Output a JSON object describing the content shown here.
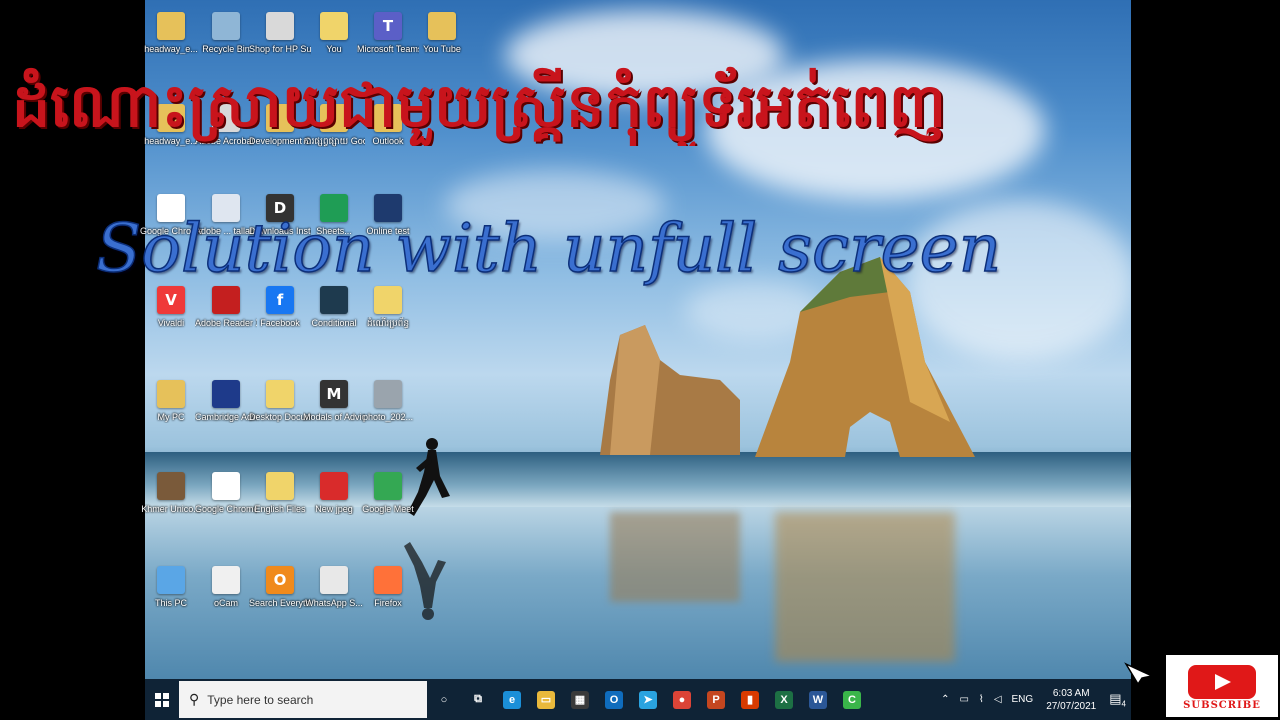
{
  "overlay": {
    "title_khmer": "ដំណោះស្រាយជាមួយស្រ្គីនកុំព្យូទ័រអត់ពេញ",
    "title_english": "Solution with unfull screen"
  },
  "desktop_icons": [
    {
      "label": "headway_e...",
      "color": "#e6c15a",
      "glyph": ""
    },
    {
      "label": "Recycle Bin",
      "color": "#8fb6d6",
      "glyph": ""
    },
    {
      "label": "Shop for HP Supplies",
      "color": "#d9d9d9",
      "glyph": ""
    },
    {
      "label": "You",
      "color": "#f0d46a",
      "glyph": ""
    },
    {
      "label": "Microsoft Teams",
      "color": "#5b5fc7",
      "glyph": "T"
    },
    {
      "label": "You Tube",
      "color": "#e6c15a",
      "glyph": ""
    },
    {
      "label": "headway_e...",
      "color": "#e6c15a",
      "glyph": ""
    },
    {
      "label": "Adobe Acrobat ...",
      "color": "#d8d8d8",
      "glyph": ""
    },
    {
      "label": "Development Courses - S...",
      "color": "#e6c15a",
      "glyph": ""
    },
    {
      "label": "ការផ្សព្វផ្សាយ Google Cl...",
      "color": "#e6c15a",
      "glyph": ""
    },
    {
      "label": "Outlook",
      "color": "#e6c15a",
      "glyph": ""
    },
    {
      "label": "Google Chrome",
      "color": "#ffffff",
      "glyph": ""
    },
    {
      "label": "Adobe ... tallation",
      "color": "#dfe6f0",
      "glyph": ""
    },
    {
      "label": "Downloads Installation...",
      "color": "#333333",
      "glyph": "D"
    },
    {
      "label": "Sheets...",
      "color": "#1f9d55",
      "glyph": ""
    },
    {
      "label": "Online test",
      "color": "#1e3a6e",
      "glyph": ""
    },
    {
      "label": "Vivaldi",
      "color": "#ef3939",
      "glyph": "V"
    },
    {
      "label": "Adobe Reader XI",
      "color": "#c41f1f",
      "glyph": ""
    },
    {
      "label": "Facebook",
      "color": "#1877f2",
      "glyph": "f"
    },
    {
      "label": "Conditional",
      "color": "#1e3a4e",
      "glyph": ""
    },
    {
      "label": "ដំណើរប្រព័ន្ធ",
      "color": "#f0d46a",
      "glyph": ""
    },
    {
      "label": "My PC",
      "color": "#e6c15a",
      "glyph": ""
    },
    {
      "label": "Cambridge Advanced...",
      "color": "#1e3a8a",
      "glyph": ""
    },
    {
      "label": "Desktop Documents",
      "color": "#f0d46a",
      "glyph": ""
    },
    {
      "label": "Modals of Advice 1 - ...",
      "color": "#333333",
      "glyph": "M"
    },
    {
      "label": "photo_202...",
      "color": "#9aa4ad",
      "glyph": ""
    },
    {
      "label": "Khmer Unico...",
      "color": "#7a5a3a",
      "glyph": ""
    },
    {
      "label": "Google Chrome",
      "color": "#ffffff",
      "glyph": ""
    },
    {
      "label": "English Files",
      "color": "#f0d46a",
      "glyph": ""
    },
    {
      "label": "New jpeg",
      "color": "#d92b2b",
      "glyph": ""
    },
    {
      "label": "Google Meet",
      "color": "#34a853",
      "glyph": ""
    },
    {
      "label": "This PC",
      "color": "#5aa6e6",
      "glyph": ""
    },
    {
      "label": "oCam",
      "color": "#f0f0f0",
      "glyph": ""
    },
    {
      "label": "Search Everything",
      "color": "#f08a1c",
      "glyph": "O"
    },
    {
      "label": "WhatsApp S...",
      "color": "#e8e8e8",
      "glyph": ""
    },
    {
      "label": "Firefox",
      "color": "#ff7139",
      "glyph": ""
    }
  ],
  "taskbar": {
    "search_placeholder": "Type here to search",
    "apps": [
      {
        "name": "cortana",
        "glyph": "○",
        "color": "transparent"
      },
      {
        "name": "task-view",
        "glyph": "⧉",
        "color": "transparent"
      },
      {
        "name": "edge",
        "glyph": "e",
        "color": "#1b8fd8"
      },
      {
        "name": "file-explorer",
        "glyph": "▭",
        "color": "#e9b93c"
      },
      {
        "name": "store",
        "glyph": "▦",
        "color": "#3a3a3a"
      },
      {
        "name": "outlook",
        "glyph": "O",
        "color": "#0f6cbd"
      },
      {
        "name": "telegram",
        "glyph": "➤",
        "color": "#2aa3e0"
      },
      {
        "name": "chrome",
        "glyph": "●",
        "color": "#db4437"
      },
      {
        "name": "powerpoint",
        "glyph": "P",
        "color": "#c4461f"
      },
      {
        "name": "office",
        "glyph": "▮",
        "color": "#d83b01"
      },
      {
        "name": "excel",
        "glyph": "X",
        "color": "#1d7044"
      },
      {
        "name": "word",
        "glyph": "W",
        "color": "#2b5797"
      },
      {
        "name": "camtasia",
        "glyph": "C",
        "color": "#3ab54a"
      }
    ],
    "tray": {
      "language": "ENG",
      "time": "6:03 AM",
      "date": "27/07/2021",
      "notifications": "4"
    }
  },
  "subscribe": {
    "label": "SUBSCRIBE"
  }
}
